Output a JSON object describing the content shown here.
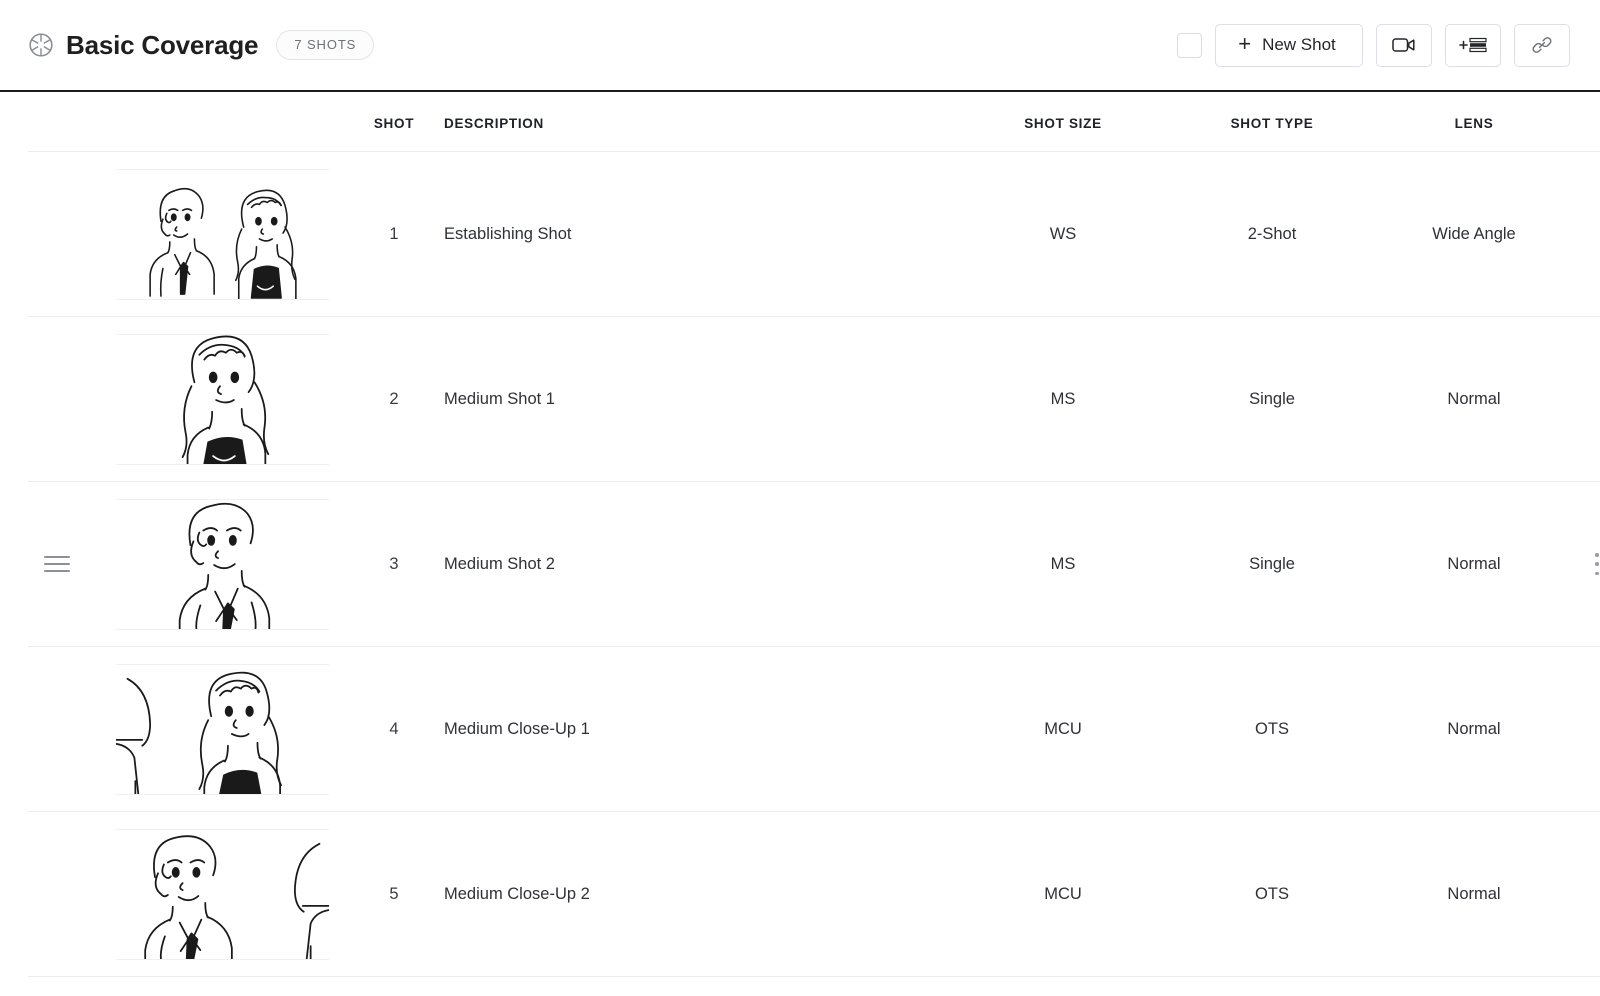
{
  "header": {
    "logo_icon": "aperture-icon",
    "title": "Basic Coverage",
    "badge": "7 SHOTS",
    "select_all_checkbox": "",
    "new_shot_label": "New Shot",
    "new_shot_plus": "+",
    "video_button_icon": "video-camera-icon",
    "add_rows_button_icon": "add-stripboard-icon",
    "link_button_icon": "link-icon"
  },
  "table": {
    "columns": [
      "SHOT",
      "DESCRIPTION",
      "SHOT SIZE",
      "SHOT TYPE",
      "LENS"
    ],
    "rows": [
      {
        "shot": "1",
        "description": "Establishing Shot",
        "shot_size": "WS",
        "shot_type": "2-Shot",
        "lens": "Wide Angle",
        "thumb": "two-characters-wide"
      },
      {
        "shot": "2",
        "description": "Medium Shot 1",
        "shot_size": "MS",
        "shot_type": "Single",
        "lens": "Normal",
        "thumb": "woman-medium"
      },
      {
        "shot": "3",
        "description": "Medium Shot 2",
        "shot_size": "MS",
        "shot_type": "Single",
        "lens": "Normal",
        "thumb": "man-medium"
      },
      {
        "shot": "4",
        "description": "Medium Close-Up 1",
        "shot_size": "MCU",
        "shot_type": "OTS",
        "lens": "Normal",
        "thumb": "woman-ots"
      },
      {
        "shot": "5",
        "description": "Medium Close-Up 2",
        "shot_size": "MCU",
        "shot_type": "OTS",
        "lens": "Normal",
        "thumb": "man-ots"
      }
    ]
  },
  "colors": {
    "border_strong": "#1c1c1c",
    "border_light": "#eeeef2",
    "text_primary": "#2b2b2b",
    "text_muted": "#6d7178"
  }
}
